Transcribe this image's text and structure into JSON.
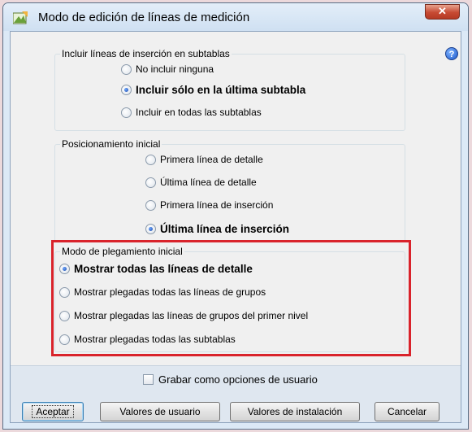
{
  "window": {
    "title": "Modo de edición de líneas de medición",
    "close_glyph": "✕",
    "help_glyph": "?"
  },
  "groups": [
    {
      "label": "Incluir líneas de inserción en subtablas",
      "options": [
        {
          "label": "No incluir ninguna",
          "checked": false,
          "bold": false
        },
        {
          "label": "Incluir sólo en la última subtabla",
          "checked": true,
          "bold": true
        },
        {
          "label": "Incluir en todas las subtablas",
          "checked": false,
          "bold": false
        }
      ]
    },
    {
      "label": "Posicionamiento inicial",
      "options": [
        {
          "label": "Primera línea de detalle",
          "checked": false,
          "bold": false
        },
        {
          "label": "Última línea de detalle",
          "checked": false,
          "bold": false
        },
        {
          "label": "Primera línea de inserción",
          "checked": false,
          "bold": false
        },
        {
          "label": "Última línea de inserción",
          "checked": true,
          "bold": true
        }
      ]
    },
    {
      "label": "Modo de plegamiento inicial",
      "options": [
        {
          "label": "Mostrar todas las líneas de detalle",
          "checked": true,
          "bold": true
        },
        {
          "label": "Mostrar plegadas todas las líneas de grupos",
          "checked": false,
          "bold": false
        },
        {
          "label": "Mostrar plegadas las líneas de grupos del primer nivel",
          "checked": false,
          "bold": false
        },
        {
          "label": "Mostrar plegadas todas las subtablas",
          "checked": false,
          "bold": false
        }
      ]
    }
  ],
  "save_options": {
    "label": "Grabar como opciones de usuario",
    "checked": false
  },
  "buttons": {
    "accept": "Aceptar",
    "user_values": "Valores de usuario",
    "install_values": "Valores de instalación",
    "cancel": "Cancelar"
  },
  "colors": {
    "highlight": "#d9232b",
    "accent": "#3c7fb1"
  }
}
